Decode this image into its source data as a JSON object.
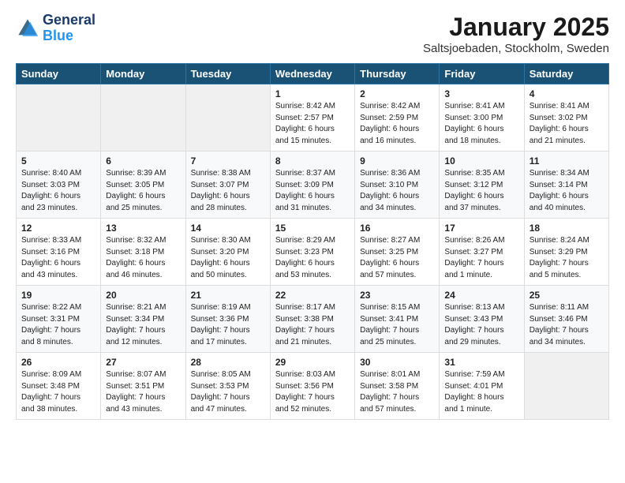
{
  "header": {
    "logo_line1": "General",
    "logo_line2": "Blue",
    "title": "January 2025",
    "subtitle": "Saltsjoebaden, Stockholm, Sweden"
  },
  "weekdays": [
    "Sunday",
    "Monday",
    "Tuesday",
    "Wednesday",
    "Thursday",
    "Friday",
    "Saturday"
  ],
  "weeks": [
    [
      {
        "day": "",
        "info": ""
      },
      {
        "day": "",
        "info": ""
      },
      {
        "day": "",
        "info": ""
      },
      {
        "day": "1",
        "info": "Sunrise: 8:42 AM\nSunset: 2:57 PM\nDaylight: 6 hours\nand 15 minutes."
      },
      {
        "day": "2",
        "info": "Sunrise: 8:42 AM\nSunset: 2:59 PM\nDaylight: 6 hours\nand 16 minutes."
      },
      {
        "day": "3",
        "info": "Sunrise: 8:41 AM\nSunset: 3:00 PM\nDaylight: 6 hours\nand 18 minutes."
      },
      {
        "day": "4",
        "info": "Sunrise: 8:41 AM\nSunset: 3:02 PM\nDaylight: 6 hours\nand 21 minutes."
      }
    ],
    [
      {
        "day": "5",
        "info": "Sunrise: 8:40 AM\nSunset: 3:03 PM\nDaylight: 6 hours\nand 23 minutes."
      },
      {
        "day": "6",
        "info": "Sunrise: 8:39 AM\nSunset: 3:05 PM\nDaylight: 6 hours\nand 25 minutes."
      },
      {
        "day": "7",
        "info": "Sunrise: 8:38 AM\nSunset: 3:07 PM\nDaylight: 6 hours\nand 28 minutes."
      },
      {
        "day": "8",
        "info": "Sunrise: 8:37 AM\nSunset: 3:09 PM\nDaylight: 6 hours\nand 31 minutes."
      },
      {
        "day": "9",
        "info": "Sunrise: 8:36 AM\nSunset: 3:10 PM\nDaylight: 6 hours\nand 34 minutes."
      },
      {
        "day": "10",
        "info": "Sunrise: 8:35 AM\nSunset: 3:12 PM\nDaylight: 6 hours\nand 37 minutes."
      },
      {
        "day": "11",
        "info": "Sunrise: 8:34 AM\nSunset: 3:14 PM\nDaylight: 6 hours\nand 40 minutes."
      }
    ],
    [
      {
        "day": "12",
        "info": "Sunrise: 8:33 AM\nSunset: 3:16 PM\nDaylight: 6 hours\nand 43 minutes."
      },
      {
        "day": "13",
        "info": "Sunrise: 8:32 AM\nSunset: 3:18 PM\nDaylight: 6 hours\nand 46 minutes."
      },
      {
        "day": "14",
        "info": "Sunrise: 8:30 AM\nSunset: 3:20 PM\nDaylight: 6 hours\nand 50 minutes."
      },
      {
        "day": "15",
        "info": "Sunrise: 8:29 AM\nSunset: 3:23 PM\nDaylight: 6 hours\nand 53 minutes."
      },
      {
        "day": "16",
        "info": "Sunrise: 8:27 AM\nSunset: 3:25 PM\nDaylight: 6 hours\nand 57 minutes."
      },
      {
        "day": "17",
        "info": "Sunrise: 8:26 AM\nSunset: 3:27 PM\nDaylight: 7 hours\nand 1 minute."
      },
      {
        "day": "18",
        "info": "Sunrise: 8:24 AM\nSunset: 3:29 PM\nDaylight: 7 hours\nand 5 minutes."
      }
    ],
    [
      {
        "day": "19",
        "info": "Sunrise: 8:22 AM\nSunset: 3:31 PM\nDaylight: 7 hours\nand 8 minutes."
      },
      {
        "day": "20",
        "info": "Sunrise: 8:21 AM\nSunset: 3:34 PM\nDaylight: 7 hours\nand 12 minutes."
      },
      {
        "day": "21",
        "info": "Sunrise: 8:19 AM\nSunset: 3:36 PM\nDaylight: 7 hours\nand 17 minutes."
      },
      {
        "day": "22",
        "info": "Sunrise: 8:17 AM\nSunset: 3:38 PM\nDaylight: 7 hours\nand 21 minutes."
      },
      {
        "day": "23",
        "info": "Sunrise: 8:15 AM\nSunset: 3:41 PM\nDaylight: 7 hours\nand 25 minutes."
      },
      {
        "day": "24",
        "info": "Sunrise: 8:13 AM\nSunset: 3:43 PM\nDaylight: 7 hours\nand 29 minutes."
      },
      {
        "day": "25",
        "info": "Sunrise: 8:11 AM\nSunset: 3:46 PM\nDaylight: 7 hours\nand 34 minutes."
      }
    ],
    [
      {
        "day": "26",
        "info": "Sunrise: 8:09 AM\nSunset: 3:48 PM\nDaylight: 7 hours\nand 38 minutes."
      },
      {
        "day": "27",
        "info": "Sunrise: 8:07 AM\nSunset: 3:51 PM\nDaylight: 7 hours\nand 43 minutes."
      },
      {
        "day": "28",
        "info": "Sunrise: 8:05 AM\nSunset: 3:53 PM\nDaylight: 7 hours\nand 47 minutes."
      },
      {
        "day": "29",
        "info": "Sunrise: 8:03 AM\nSunset: 3:56 PM\nDaylight: 7 hours\nand 52 minutes."
      },
      {
        "day": "30",
        "info": "Sunrise: 8:01 AM\nSunset: 3:58 PM\nDaylight: 7 hours\nand 57 minutes."
      },
      {
        "day": "31",
        "info": "Sunrise: 7:59 AM\nSunset: 4:01 PM\nDaylight: 8 hours\nand 1 minute."
      },
      {
        "day": "",
        "info": ""
      }
    ]
  ]
}
